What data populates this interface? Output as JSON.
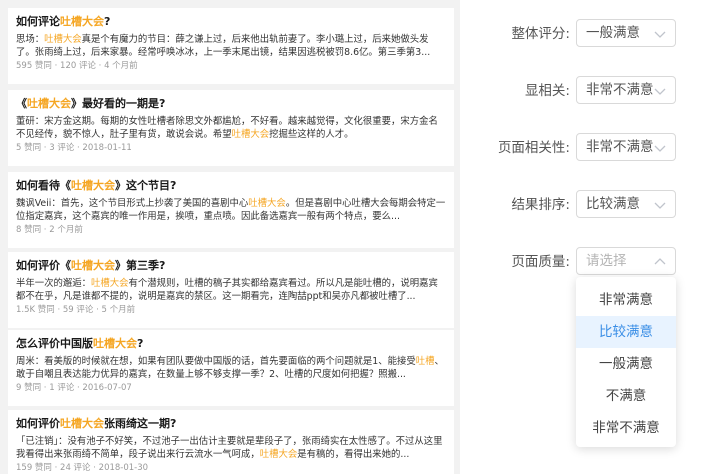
{
  "results": [
    {
      "title_pre": "如何评论",
      "title_hl": "吐槽大会",
      "title_post": "?",
      "snippet_pre": "思场：",
      "snippet_hl": "吐槽大会",
      "snippet_post": "真是个有魔力的节目：薛之谦上过，后来他出轨前妻了。李小璐上过，后来她做头发了。张雨绮上过，后来家暴。经常呼唤冰冰，上一季末尾出镜，结果因逃税被罚8.6亿。第三季第3...",
      "meta": "595 赞同 · 120 评论 · 4 个月前"
    },
    {
      "title_pre": "《",
      "title_hl": "吐槽大会",
      "title_post": "》最好看的一期是?",
      "snippet_pre": "董研：宋方金这期。每期的女性吐槽者除思文外都尴尬，不好看。越来越觉得，文化很重要，宋方金名不见经传，貌不惊人，肚子里有货，敢说会说。希望",
      "snippet_hl": "吐槽大会",
      "snippet_post": "挖掘些这样的人才。",
      "meta": "5 赞同 · 3 评论 · 2018-01-11"
    },
    {
      "title_pre": "如何看待《",
      "title_hl": "吐槽大会",
      "title_post": "》这个节目?",
      "snippet_pre": "魏讽Veii：首先，这个节目形式上抄袭了美国的喜剧中心",
      "snippet_hl": "吐槽大会",
      "snippet_post": "。但是喜剧中心吐槽大会每期会特定一位指定嘉宾，这个嘉宾的唯一作用是，挨喷，重点喷。因此备选嘉宾一般有两个特点，要么...",
      "meta": "8 赞同 · 2 个月前"
    },
    {
      "title_pre": "如何评价《",
      "title_hl": "吐槽大会",
      "title_post": "》第三季?",
      "snippet_pre": "半年一次的邂逅：",
      "snippet_hl": "吐槽大会",
      "snippet_post": "有个潜规则，吐槽的稿子其实都给嘉宾看过。所以凡是能吐槽的，说明嘉宾都不在乎，凡是谁都不提的，说明是嘉宾的禁区。这一期看完，连陶喆ppt和吴亦凡都被吐槽了...",
      "meta": "1.5K 赞同 · 59 评论 · 5 个月前"
    },
    {
      "title_pre": "怎么评价中国版",
      "title_hl": "吐槽大会",
      "title_post": "?",
      "snippet_pre": "周米：看美版的时候就在想，如果有团队要做中国版的话，首先要面临的两个问题就是1、能接受",
      "snippet_hl": "吐槽",
      "snippet_post": "、敢于自嘲且表达能力优异的嘉宾，在数量上够不够支撑一季？2、吐槽的尺度如何把握？照搬...",
      "meta": "9 赞同 · 1 评论 · 2016-07-07"
    },
    {
      "title_pre": "如何评价",
      "title_hl": "吐槽大会",
      "title_post": "张雨绮这一期?",
      "snippet_pre": "「已注销」：没有池子不好笑，不过池子一出估计主要就是辈段子了，张雨绮实在太性感了。不过从这里我看得出来张雨绮不简单，段子说出来行云流水一气呵成，",
      "snippet_hl": "吐槽大会",
      "snippet_post": "是有稿的，看得出来她的...",
      "meta": "159 赞同 · 24 评论 · 2018-01-30"
    }
  ],
  "form": {
    "fields": [
      {
        "label": "整体评分:",
        "value": "一般满意"
      },
      {
        "label": "显相关:",
        "value": "非常不满意"
      },
      {
        "label": "页面相关性:",
        "value": "非常不满意"
      },
      {
        "label": "结果排序:",
        "value": "比较满意"
      },
      {
        "label": "页面质量:",
        "placeholder": "请选择"
      }
    ],
    "dropdown_options": [
      "非常满意",
      "比较满意",
      "一般满意",
      "不满意",
      "非常不满意"
    ],
    "dropdown_highlighted": "比较满意"
  },
  "colors": {
    "highlight": "#f5a623",
    "option_active_bg": "#e8f3ff",
    "option_active_text": "#3a8ee6"
  }
}
